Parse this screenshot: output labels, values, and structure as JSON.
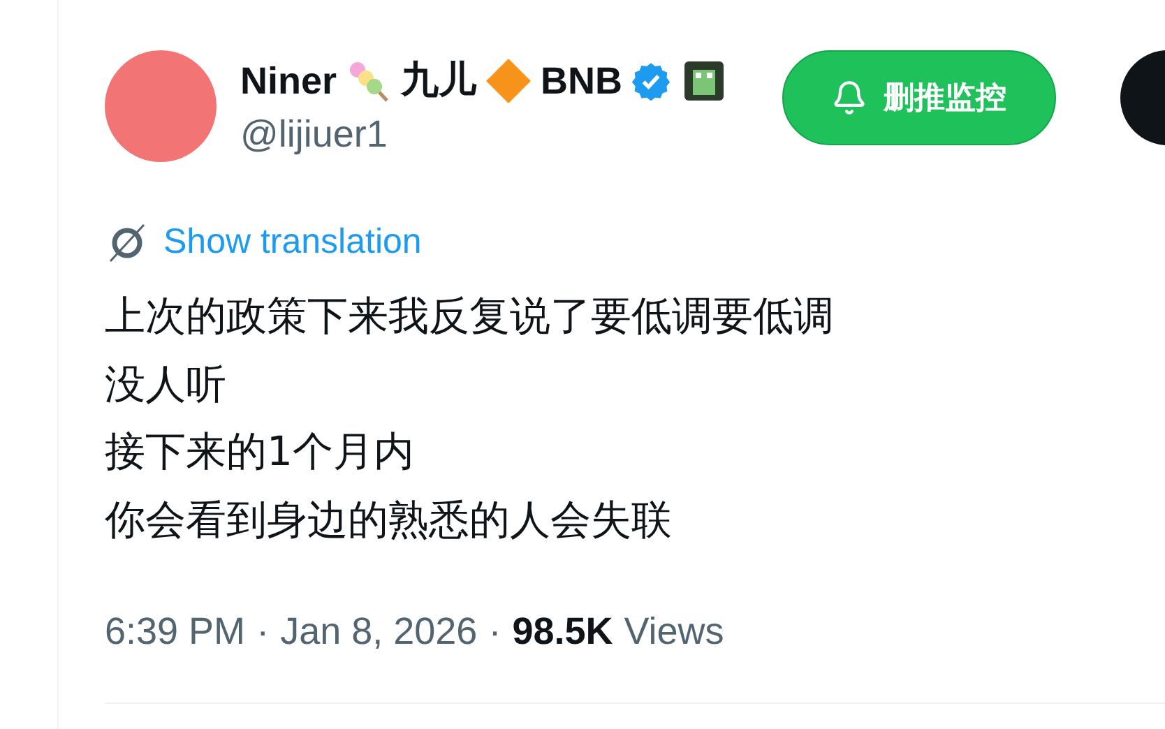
{
  "author": {
    "name_parts": [
      "Niner",
      "九儿",
      "BNB"
    ],
    "handle": "@lijiuer1",
    "verified": true
  },
  "monitor_button": {
    "label": "删推监控"
  },
  "translation_link": "Show translation",
  "tweet_lines": [
    "上次的政策下来我反复说了要低调要低调",
    "没人听",
    "接下来的1个月内",
    "你会看到身边的熟悉的人会失联"
  ],
  "meta": {
    "time": "6:39 PM",
    "date": "Jan 8, 2026",
    "views_count": "98.5K",
    "views_label": "Views",
    "separator": "·"
  }
}
